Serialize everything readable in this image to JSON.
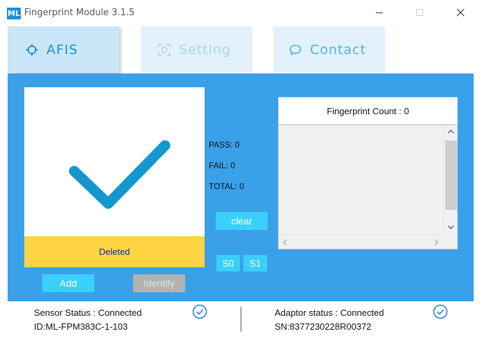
{
  "window": {
    "logo_text": "ML",
    "title": "Fingerprint Module 3.1.5"
  },
  "tabs": [
    {
      "label": "AFIS",
      "icon": "crosshair-icon",
      "active": true
    },
    {
      "label": "Setting",
      "icon": "fingerprint-scan-icon",
      "active": false
    },
    {
      "label": "Contact",
      "icon": "chat-bubble-icon",
      "active": false
    }
  ],
  "fingerprint": {
    "status_text": "Deleted",
    "result_icon": "checkmark-icon"
  },
  "buttons": {
    "add": "Add",
    "identify": "Identify",
    "clear": "clear",
    "s0": "S0",
    "s1": "S1"
  },
  "stats": {
    "pass": "PASS: 0",
    "fail": "FAIL:  0",
    "total": "TOTAL: 0"
  },
  "fingerprint_count": {
    "header": "Fingerprint Count : 0"
  },
  "footer": {
    "sensor_status": "Sensor Status : Connected",
    "sensor_id": "ID:ML-FPM383C-1-103",
    "adaptor_status": "Adaptor status : Connected",
    "adaptor_sn": "SN:8377230228R00372"
  },
  "colors": {
    "panel": "#3aa0e8",
    "accent_button": "#3ad0fb",
    "status_bar": "#fed344",
    "checkmark": "#1497cc"
  }
}
